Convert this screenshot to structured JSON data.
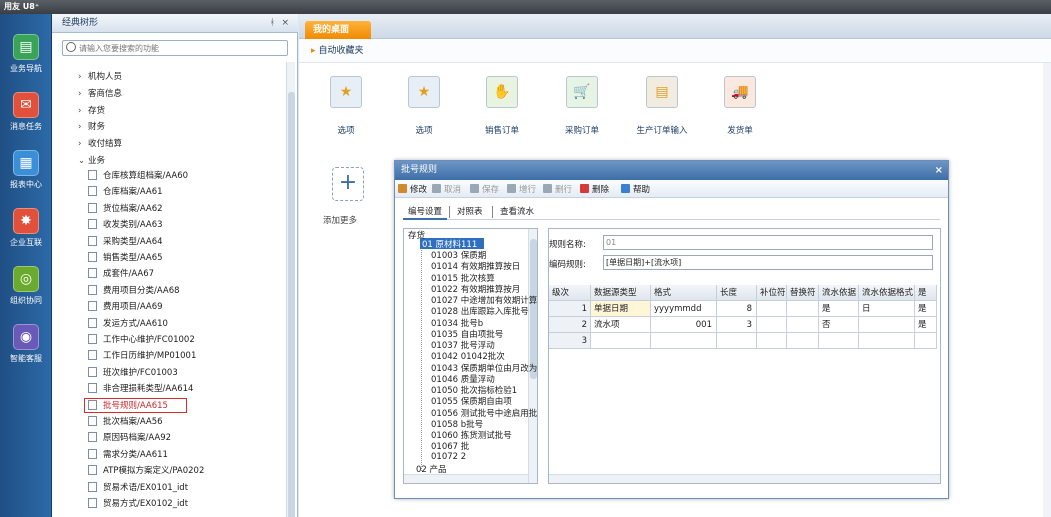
{
  "app": {
    "title": "用友 U8⁺"
  },
  "nav": {
    "items": [
      {
        "label": "业务导航",
        "color": "#3aa35a",
        "icon": "business-nav-icon",
        "glyph": "▤"
      },
      {
        "label": "消息任务",
        "color": "#e0503a",
        "icon": "message-task-icon",
        "glyph": "✉"
      },
      {
        "label": "报表中心",
        "color": "#3b8fd6",
        "icon": "report-center-icon",
        "glyph": "▦"
      },
      {
        "label": "企业互联",
        "color": "#e0503a",
        "icon": "enterprise-connect-icon",
        "glyph": "✸"
      },
      {
        "label": "组织协同",
        "color": "#6aaa2e",
        "icon": "org-collab-icon",
        "glyph": "◎"
      },
      {
        "label": "智能客服",
        "color": "#6a5ab8",
        "icon": "smart-service-icon",
        "glyph": "◉"
      }
    ]
  },
  "tree": {
    "header": "经典树形",
    "pin": "ᚼ",
    "close": "×",
    "search_placeholder": "请输入您要搜索的功能",
    "roots": [
      {
        "label": "机构人员",
        "expanded": false
      },
      {
        "label": "客商信息",
        "expanded": false
      },
      {
        "label": "存货",
        "expanded": false
      },
      {
        "label": "财务",
        "expanded": false
      },
      {
        "label": "收付结算",
        "expanded": false
      },
      {
        "label": "业务",
        "expanded": true
      }
    ],
    "leaves": [
      "仓库核算组档案/AA60",
      "仓库档案/AA61",
      "货位档案/AA62",
      "收发类别/AA63",
      "采购类型/AA64",
      "销售类型/AA65",
      "成套件/AA67",
      "费用项目分类/AA68",
      "费用项目/AA69",
      "发运方式/AA610",
      "工作中心维护/FC01002",
      "工作日历维护/MP01001",
      "班次维护/FC01003",
      "非合理损耗类型/AA614",
      "批号规则/AA615",
      "批次档案/AA56",
      "原因码档案/AA92",
      "需求分类/AA611",
      "ATP模拟方案定义/PA0202",
      "贸易术语/EX0101_idt",
      "贸易方式/EX0102_idt"
    ],
    "selected_index": 14
  },
  "workspace": {
    "tab": "我的桌面",
    "favorites": "自动收藏夹",
    "shortcuts": [
      {
        "label": "选项",
        "icon": "options-doc-icon",
        "color": "#e8eef5",
        "glyph": "★"
      },
      {
        "label": "选项",
        "icon": "options-doc-icon",
        "color": "#e8eef5",
        "glyph": "★"
      },
      {
        "label": "销售订单",
        "icon": "sales-order-icon",
        "color": "#e8f3e0",
        "glyph": "✋"
      },
      {
        "label": "采购订单",
        "icon": "purchase-order-icon",
        "color": "#e6f4e6",
        "glyph": "🛒"
      },
      {
        "label": "生产订单输入",
        "icon": "production-order-icon",
        "color": "#f2ebe0",
        "glyph": "▤"
      },
      {
        "label": "发货单",
        "icon": "delivery-note-icon",
        "color": "#fbe9df",
        "glyph": "🚚"
      }
    ],
    "add_more_glyph": "+",
    "add_more_label": "添加更多"
  },
  "dialog": {
    "title": "批号规则",
    "close": "×",
    "toolbar": [
      {
        "label": "修改",
        "enabled": true,
        "color": "#d08a2e",
        "icon": "edit-icon"
      },
      {
        "label": "取消",
        "enabled": false,
        "color": "#9aa7b5",
        "icon": "cancel-icon"
      },
      {
        "label": "保存",
        "enabled": false,
        "color": "#9aa7b5",
        "icon": "save-icon"
      },
      {
        "label": "增行",
        "enabled": false,
        "color": "#9aa7b5",
        "icon": "add-row-icon"
      },
      {
        "label": "删行",
        "enabled": false,
        "color": "#9aa7b5",
        "icon": "delete-row-icon"
      },
      {
        "label": "删除",
        "enabled": true,
        "color": "#d83a3a",
        "icon": "delete-icon"
      },
      {
        "label": "帮助",
        "enabled": true,
        "color": "#3b7fd0",
        "icon": "help-icon"
      }
    ],
    "tabs": [
      "编号设置",
      "对照表",
      "查看流水"
    ],
    "active_tab": 0,
    "tree": {
      "root": "存货",
      "selected": "01 原材料111",
      "children": [
        "01003 保质期",
        "01014 有效期推算按日",
        "01015 批次核算",
        "01022 有效期推算按月",
        "01027 中途增加有效期计算",
        "01028 出库跟踪入库批号",
        "01034 批号b",
        "01035 自由项批号",
        "01037 批号浮动",
        "01042 01042批次",
        "01043 保质期单位由月改为",
        "01046 质量浮动",
        "01050 批次指标检验1",
        "01055 保质期自由项",
        "01056 测试批号中途启用批",
        "01058 b批号",
        "01060 拣货测试批号",
        "01067 批",
        "01072 2"
      ],
      "sibling": "02 产品"
    },
    "form": {
      "rule_name_label": "规则名称:",
      "rule_name_value": "01",
      "code_rule_label": "编码规则:",
      "code_rule_value": "[单据日期]+[流水项]"
    },
    "grid": {
      "headers": [
        "级次",
        "数据源类型",
        "格式",
        "长度",
        "补位符",
        "替换符",
        "流水依据",
        "流水依据格式",
        "是"
      ],
      "rows": [
        [
          "1",
          "单据日期",
          "yyyymmdd",
          "8",
          "",
          "",
          "是",
          "日",
          "是"
        ],
        [
          "2",
          "流水项",
          "001",
          "3",
          "",
          "",
          "否",
          "",
          "是"
        ],
        [
          "3",
          "",
          "",
          "",
          "",
          "",
          "",
          "",
          ""
        ]
      ]
    }
  }
}
